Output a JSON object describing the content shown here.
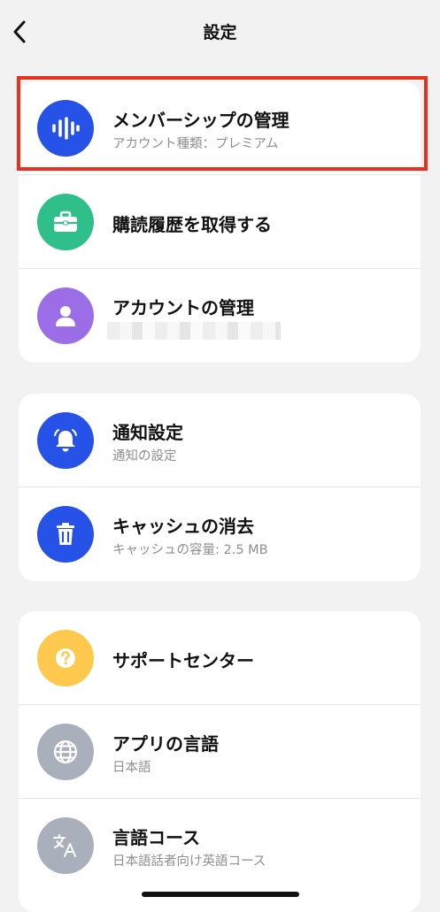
{
  "header": {
    "title": "設定",
    "back_icon": "chevron-left-icon"
  },
  "groups": [
    {
      "items": [
        {
          "title": "メンバーシップの管理",
          "subtitle": "アカウント種類：プレミアム",
          "icon": "audio-waveform-icon",
          "color": "#2752e7"
        },
        {
          "title": "購読履歴を取得する",
          "icon": "briefcase-icon",
          "color": "#2fbf8a"
        },
        {
          "title": "アカウントの管理",
          "subtitle_redacted": true,
          "icon": "person-icon",
          "color": "#9b6ee8"
        }
      ]
    },
    {
      "items": [
        {
          "title": "通知設定",
          "subtitle": "通知の設定",
          "icon": "bell-icon",
          "color": "#2752e7"
        },
        {
          "title": "キャッシュの消去",
          "subtitle": "キャッシュの容量: 2.5 MB",
          "icon": "trash-icon",
          "color": "#2752e7"
        }
      ]
    },
    {
      "items": [
        {
          "title": "サポートセンター",
          "icon": "question-icon",
          "color": "#ffc94d"
        },
        {
          "title": "アプリの言語",
          "subtitle": "日本語",
          "icon": "globe-icon",
          "color": "#a9b0bb"
        },
        {
          "title": "言語コース",
          "subtitle": "日本語話者向け英語コース",
          "icon": "translate-icon",
          "color": "#a9b0bb"
        }
      ]
    }
  ],
  "highlight_color": "#e8321e"
}
